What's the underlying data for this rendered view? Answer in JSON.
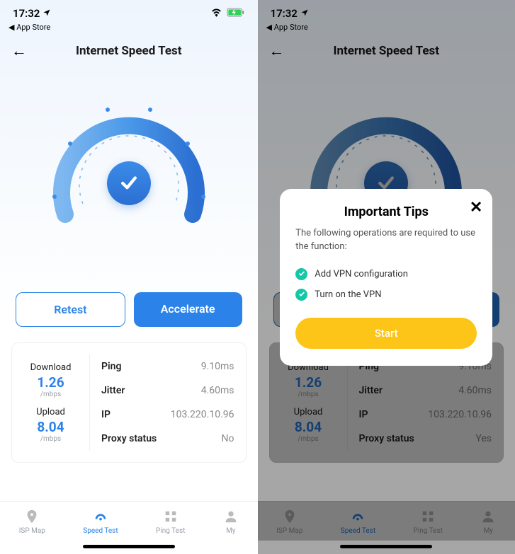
{
  "status": {
    "time": "17:32",
    "back_store": "App Store"
  },
  "header": {
    "title": "Internet Speed Test"
  },
  "buttons": {
    "retest": "Retest",
    "accelerate": "Accelerate"
  },
  "download": {
    "label": "Download",
    "value": "1.26",
    "unit": "/mbps"
  },
  "upload": {
    "label": "Upload",
    "value": "8.04",
    "unit": "/mbps"
  },
  "metrics": {
    "ping_label": "Ping",
    "ping_value": "9.10ms",
    "jitter_label": "Jitter",
    "jitter_value": "4.60ms",
    "ip_label": "IP",
    "ip_value": "103.220.10.96",
    "proxy_label": "Proxy status"
  },
  "proxy_left": "No",
  "proxy_right": "Yes",
  "tabs": {
    "isp": "ISP Map",
    "speed": "Speed Test",
    "ping": "Ping Test",
    "my": "My"
  },
  "modal": {
    "title": "Important Tips",
    "desc": "The following operations are required to use the function:",
    "item1": "Add VPN configuration",
    "item2": "Turn on the VPN",
    "start": "Start"
  }
}
